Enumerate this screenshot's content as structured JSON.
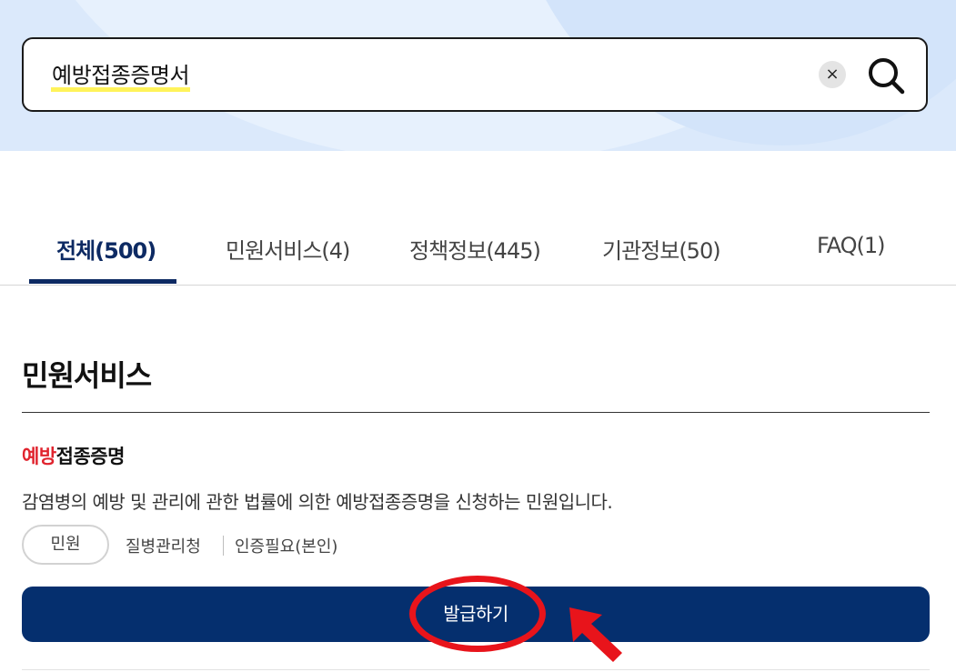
{
  "search": {
    "query": "예방접종증명서",
    "clear_label": "×"
  },
  "tabs": [
    {
      "label": "전체(500)",
      "active": true
    },
    {
      "label": "민원서비스(4)",
      "active": false
    },
    {
      "label": "정책정보(445)",
      "active": false
    },
    {
      "label": "기관정보(50)",
      "active": false
    },
    {
      "label": "FAQ(1)",
      "active": false
    }
  ],
  "section": {
    "title": "민원서비스"
  },
  "result": {
    "title_highlight": "예방",
    "title_rest": "접종증명",
    "description": "감염병의 예방 및 관리에 관한 법률에 의한 예방접종증명을 신청하는 민원입니다.",
    "badge": "민원",
    "org": "질병관리청",
    "auth": "인증필요(본인)",
    "button_label": "발급하기"
  },
  "colors": {
    "brand_navy": "#052f6e",
    "highlight_red": "#e0242e",
    "annotation_red": "#e8141b",
    "search_highlight": "#fff35a"
  }
}
